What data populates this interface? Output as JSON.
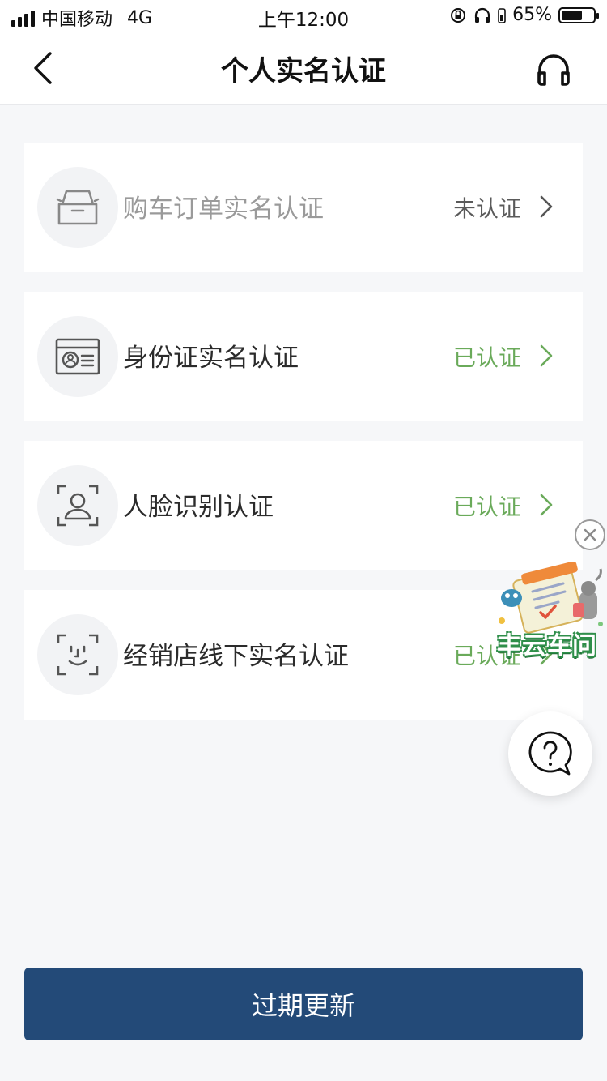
{
  "status_bar": {
    "carrier": "中国移动",
    "network": "4G",
    "time": "上午12:00",
    "battery": "65%",
    "battery_level": 0.65
  },
  "nav": {
    "title": "个人实名认证",
    "back_icon": "chevron-left-icon",
    "service_icon": "headset-icon"
  },
  "items": [
    {
      "label": "购车订单实名认证",
      "status": "未认证",
      "verified": false,
      "icon": "car-icon"
    },
    {
      "label": "身份证实名认证",
      "status": "已认证",
      "verified": true,
      "icon": "id-card-icon"
    },
    {
      "label": "人脸识别认证",
      "status": "已认证",
      "verified": true,
      "icon": "portrait-frame-icon"
    },
    {
      "label": "经销店线下实名认证",
      "status": "已认证",
      "verified": true,
      "icon": "face-scan-icon"
    }
  ],
  "floating": {
    "promo_text": "丰云车问",
    "close_icon": "close-icon",
    "help_icon": "question-chat-icon"
  },
  "footer": {
    "button_label": "过期更新"
  },
  "colors": {
    "verified": "#6aaa5a",
    "primary_button": "#234a78",
    "background": "#f6f7f9"
  }
}
